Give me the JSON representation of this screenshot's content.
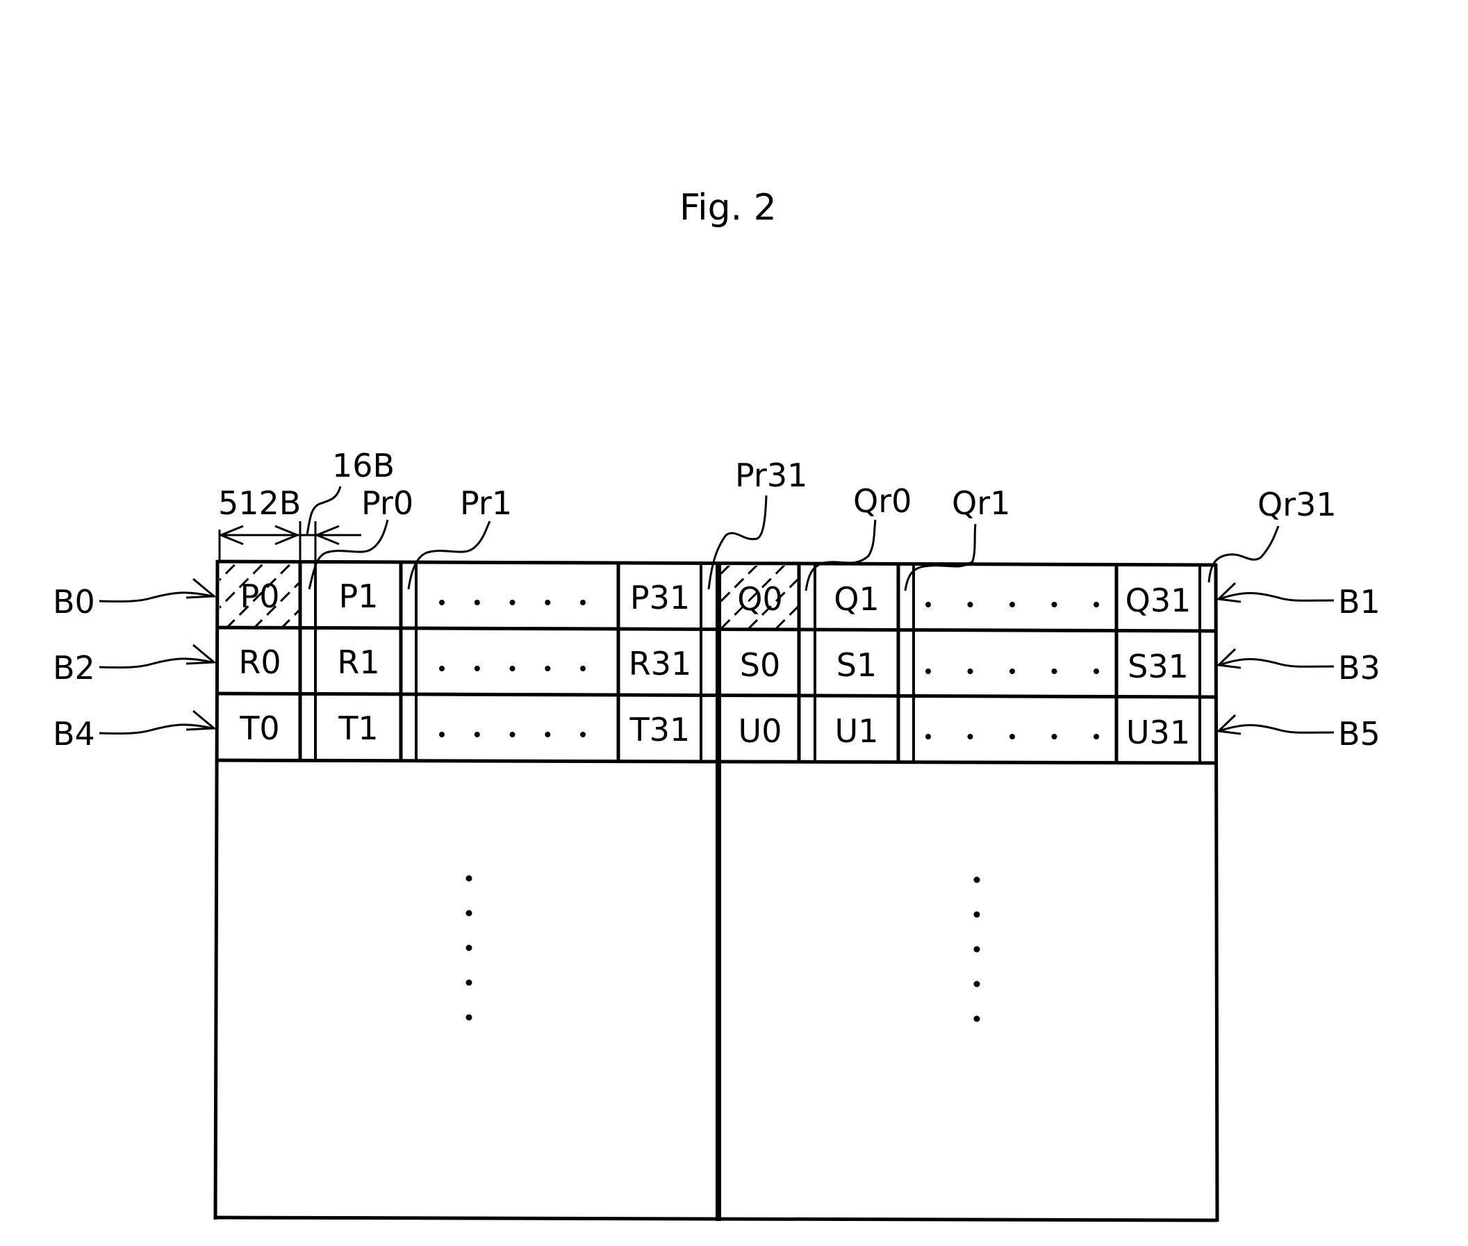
{
  "figure": {
    "title": "Fig. 2",
    "colors": {
      "ink": "#000000",
      "background": "#ffffff"
    }
  },
  "dimensions": {
    "page_size_label": "512B",
    "redundant_size_label": "16B"
  },
  "redundant_area_labels": {
    "left_block": [
      "Pr0",
      "Pr1",
      "Pr31"
    ],
    "right_block": [
      "Qr0",
      "Qr1",
      "Qr31"
    ]
  },
  "block_labels": {
    "left": [
      "B0",
      "B2",
      "B4"
    ],
    "right": [
      "B1",
      "B3",
      "B5"
    ]
  },
  "rows": [
    {
      "left_block": [
        "P0",
        "P1",
        "P31"
      ],
      "right_block": [
        "Q0",
        "Q1",
        "Q31"
      ],
      "hatched": [
        "P0",
        "Q0"
      ]
    },
    {
      "left_block": [
        "R0",
        "R1",
        "R31"
      ],
      "right_block": [
        "S0",
        "S1",
        "S31"
      ],
      "hatched": []
    },
    {
      "left_block": [
        "T0",
        "T1",
        "T31"
      ],
      "right_block": [
        "U0",
        "U1",
        "U31"
      ],
      "hatched": []
    }
  ],
  "ellipsis": {
    "horizontal_dots_per_row": 5,
    "vertical_dots_per_block": 5
  }
}
